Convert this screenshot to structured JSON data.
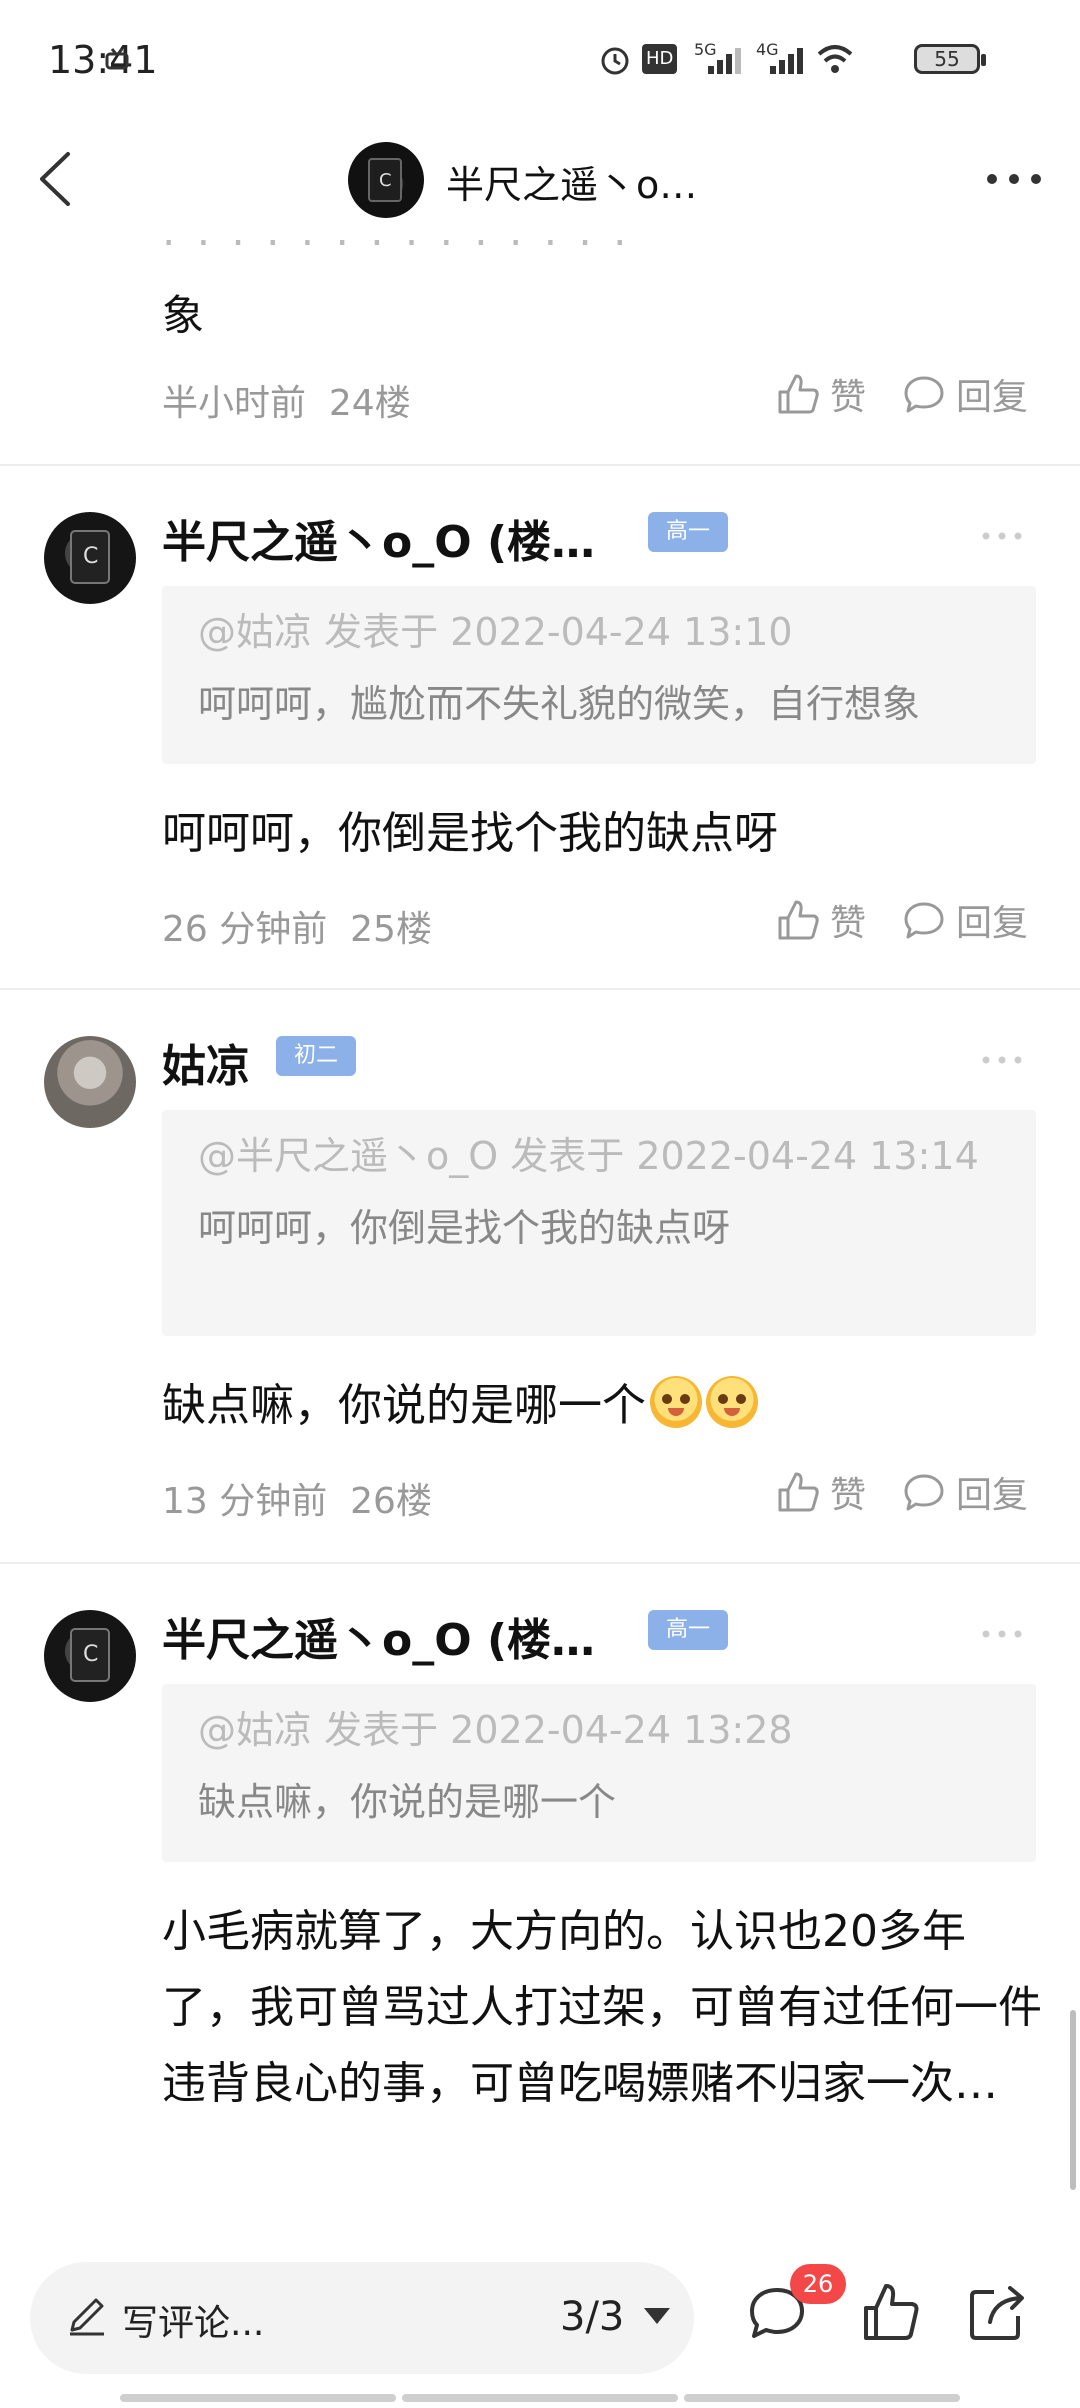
{
  "status_bar": {
    "time": "13:41",
    "battery": "55",
    "signal_labels": [
      "HD",
      "5G",
      "4G"
    ]
  },
  "header": {
    "title": "半尺之遥丶o…"
  },
  "partial_post": {
    "text_tail": "象",
    "time": "半小时前",
    "floor": "24楼",
    "like_label": "赞",
    "reply_label": "回复"
  },
  "posts": [
    {
      "username": "半尺之遥丶o_O (楼…",
      "badge": "高一",
      "quote_head": "@姑凉 发表于 2022-04-24 13:10",
      "quote_body": "呵呵呵，尴尬而不失礼貌的微笑，自行想象",
      "content": "呵呵呵，你倒是找个我的缺点呀",
      "time": "26 分钟前",
      "floor": "25楼",
      "like_label": "赞",
      "reply_label": "回复"
    },
    {
      "username": "姑凉",
      "badge": "初二",
      "quote_head": "@半尺之遥丶o_O 发表于 2022-04-24 13:14",
      "quote_body": "呵呵呵，你倒是找个我的缺点呀",
      "content": "缺点嘛，你说的是哪一个",
      "time": "13 分钟前",
      "floor": "26楼",
      "like_label": "赞",
      "reply_label": "回复"
    },
    {
      "username": "半尺之遥丶o_O (楼…",
      "badge": "高一",
      "quote_head": "@姑凉 发表于 2022-04-24 13:28",
      "quote_body": "缺点嘛，你说的是哪一个",
      "content": "小毛病就算了，大方向的。认识也20多年了，我可曾骂过人打过架，可曾有过任何一件违背良心的事，可曾吃喝嫖赌不归家一次…"
    }
  ],
  "bottom_bar": {
    "comment_placeholder": "写评论...",
    "page_indicator": "3/3",
    "comment_count": "26"
  },
  "colors": {
    "badge": "#8cb1e8",
    "count_badge": "#f44848",
    "meta_text": "#999999",
    "quote_bg": "#f5f5f5"
  }
}
